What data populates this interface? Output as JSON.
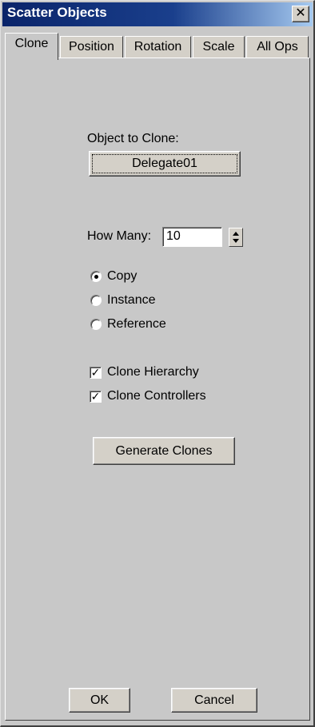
{
  "window": {
    "title": "Scatter Objects"
  },
  "tabs": [
    {
      "label": "Clone"
    },
    {
      "label": "Position"
    },
    {
      "label": "Rotation"
    },
    {
      "label": "Scale"
    },
    {
      "label": "All Ops"
    }
  ],
  "active_tab": "Clone",
  "clone": {
    "object_label": "Object to Clone:",
    "object_button": "Delegate01",
    "how_many_label": "How Many:",
    "how_many_value": "10",
    "radios": [
      {
        "label": "Copy",
        "selected": true
      },
      {
        "label": "Instance",
        "selected": false
      },
      {
        "label": "Reference",
        "selected": false
      }
    ],
    "checks": [
      {
        "label": "Clone Hierarchy",
        "checked": true
      },
      {
        "label": "Clone Controllers",
        "checked": true
      }
    ],
    "generate_button": "Generate Clones"
  },
  "footer": {
    "ok_label": "OK",
    "cancel_label": "Cancel"
  },
  "colors": {
    "title_bar": "#0a246a",
    "face": "#d4d0c8"
  }
}
